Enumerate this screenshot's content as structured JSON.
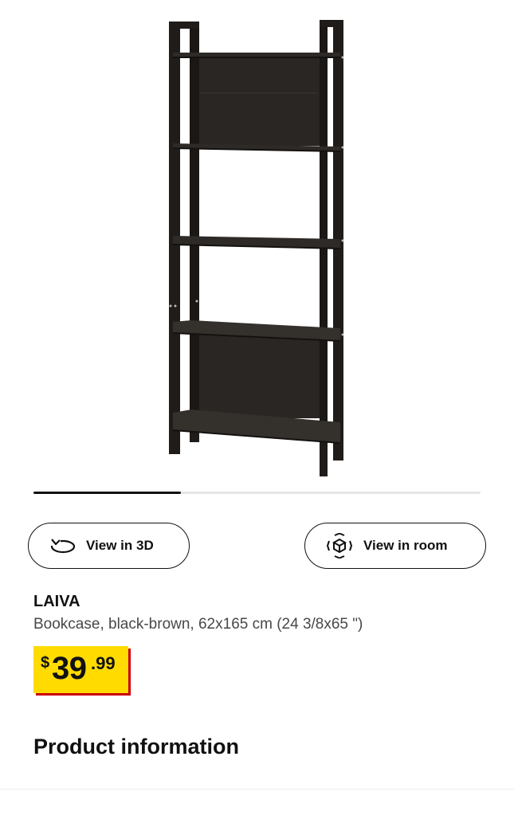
{
  "gallery": {
    "image_alt": "LAIVA Bookcase, black-brown",
    "progress_fraction": 0.33
  },
  "actions": {
    "view_3d": {
      "label": "View in 3D",
      "icon": "rotate-3d-icon"
    },
    "view_room": {
      "label": "View in room",
      "icon": "ar-cube-icon"
    }
  },
  "product": {
    "name": "LAIVA",
    "description": "Bookcase, black-brown, 62x165 cm (24 3/8x65 \")"
  },
  "price": {
    "currency": "$",
    "integer": "39",
    "decimal": ".99",
    "background_color": "#ffdb00",
    "shadow_color": "#cc0008"
  },
  "sections": {
    "product_information": "Product information"
  }
}
